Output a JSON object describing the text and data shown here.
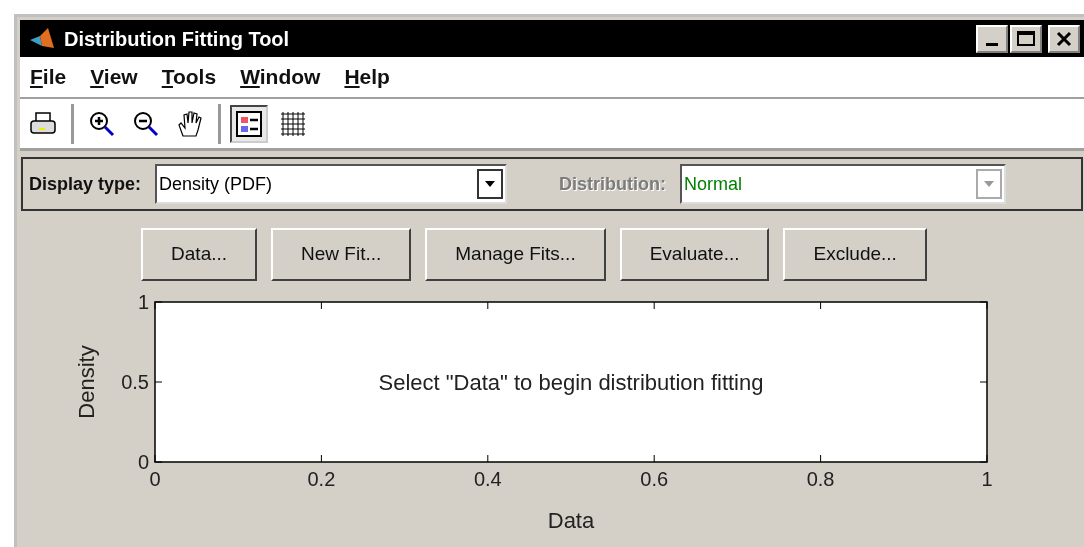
{
  "window": {
    "title": "Distribution Fitting Tool"
  },
  "menu": [
    "File",
    "View",
    "Tools",
    "Window",
    "Help"
  ],
  "toolbar": [
    {
      "kind": "print",
      "selected": false
    },
    {
      "kind": "separator"
    },
    {
      "kind": "zoom-in",
      "selected": false
    },
    {
      "kind": "zoom-out",
      "selected": false
    },
    {
      "kind": "pan",
      "selected": false
    },
    {
      "kind": "separator"
    },
    {
      "kind": "legend",
      "selected": true
    },
    {
      "kind": "grid",
      "selected": false
    }
  ],
  "display_type": {
    "label": "Display type:",
    "value": "Density (PDF)"
  },
  "distribution": {
    "label": "Distribution:",
    "value": "Normal",
    "disabled": true
  },
  "buttons": [
    "Data...",
    "New Fit...",
    "Manage Fits...",
    "Evaluate...",
    "Exclude..."
  ],
  "plot": {
    "chart_data": {
      "type": "line",
      "xlabel": "Data",
      "ylabel": "Density",
      "xlim": [
        0,
        1
      ],
      "ylim": [
        0,
        1
      ],
      "xticks": [
        0,
        {
          "value": 0.2,
          "label": "0.2"
        },
        {
          "value": 0.4,
          "label": "0.4"
        },
        {
          "value": 0.6,
          "label": "0.6"
        },
        {
          "value": 0.8,
          "label": "0.8"
        },
        1
      ],
      "yticks": [
        0,
        {
          "value": 0.5,
          "label": "0.5"
        },
        1
      ],
      "annotations": [
        "Select \"Data\" to begin distribution fitting"
      ]
    }
  }
}
